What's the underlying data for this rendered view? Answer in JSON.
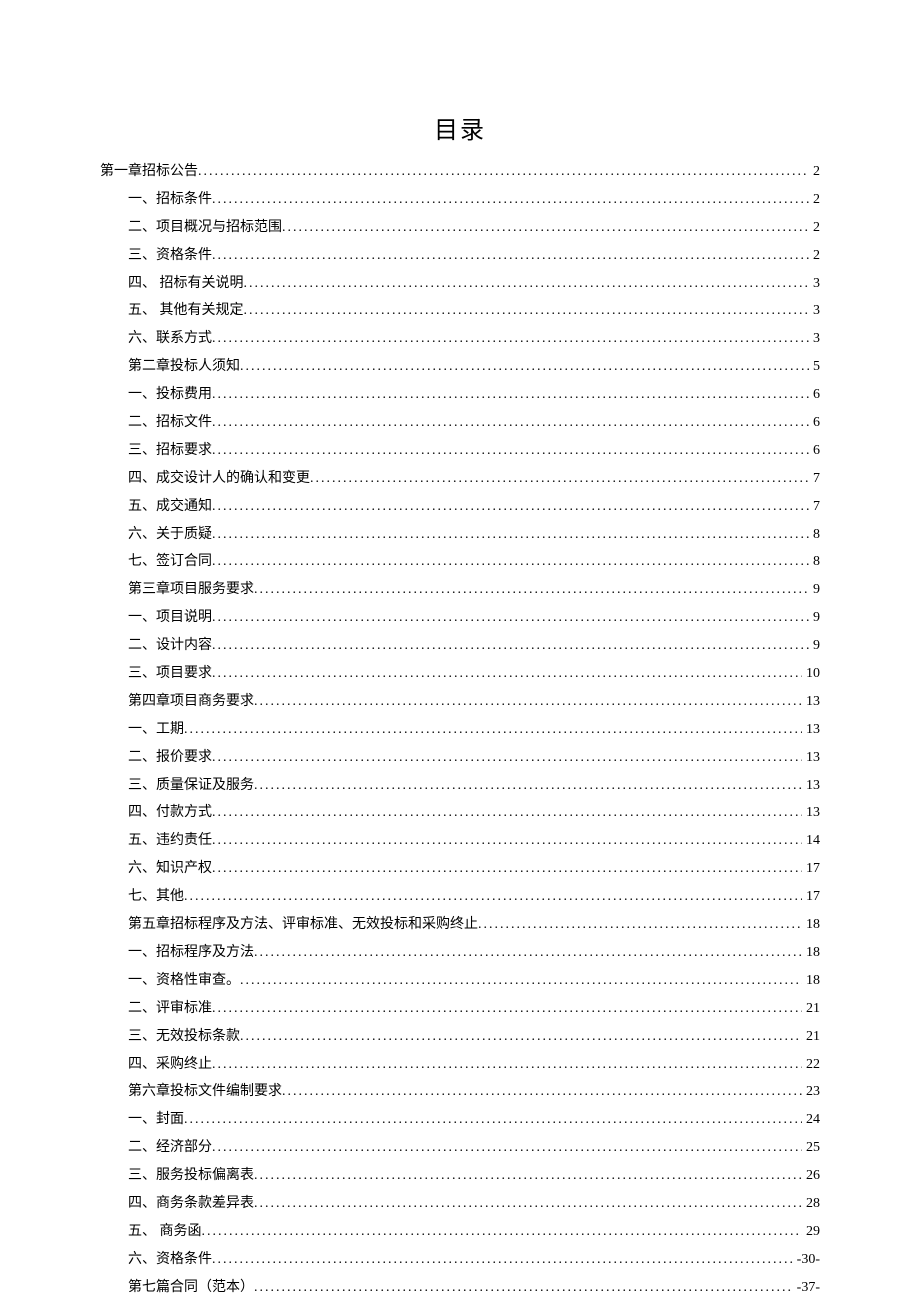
{
  "title": "目录",
  "entries": [
    {
      "level": 1,
      "label": "第一章招标公告",
      "page": "2"
    },
    {
      "level": 2,
      "label": "一、招标条件",
      "page": "2"
    },
    {
      "level": 2,
      "label": "二、项目概况与招标范围",
      "page": "2"
    },
    {
      "level": 2,
      "label": "三、资格条件",
      "page": "2"
    },
    {
      "level": 2,
      "label": "四、 招标有关说明",
      "page": "3"
    },
    {
      "level": 2,
      "label": "五、 其他有关规定",
      "page": "3"
    },
    {
      "level": 2,
      "label": "六、联系方式",
      "page": "3"
    },
    {
      "level": 2,
      "label": "第二章投标人须知",
      "page": "5"
    },
    {
      "level": 2,
      "label": "一、投标费用",
      "page": "6"
    },
    {
      "level": 2,
      "label": "二、招标文件",
      "page": "6"
    },
    {
      "level": 2,
      "label": "三、招标要求",
      "page": "6"
    },
    {
      "level": 2,
      "label": "四、成交设计人的确认和变更",
      "page": "7"
    },
    {
      "level": 2,
      "label": "五、成交通知",
      "page": "7"
    },
    {
      "level": 2,
      "label": "六、关于质疑",
      "page": "8"
    },
    {
      "level": 2,
      "label": "七、签订合同",
      "page": "8"
    },
    {
      "level": 2,
      "label": "第三章项目服务要求",
      "page": "9"
    },
    {
      "level": 2,
      "label": "一、项目说明",
      "page": "9"
    },
    {
      "level": 2,
      "label": "二、设计内容",
      "page": "9"
    },
    {
      "level": 2,
      "label": "三、项目要求 ",
      "page": " 10"
    },
    {
      "level": 2,
      "label": "第四章项目商务要求 ",
      "page": " 13"
    },
    {
      "level": 2,
      "label": "一、工期 ",
      "page": " 13"
    },
    {
      "level": 2,
      "label": "二、报价要求 ",
      "page": " 13"
    },
    {
      "level": 2,
      "label": "三、质量保证及服务 ",
      "page": " 13"
    },
    {
      "level": 2,
      "label": "四、付款方式 ",
      "page": " 13"
    },
    {
      "level": 2,
      "label": "五、违约责任 ",
      "page": " 14"
    },
    {
      "level": 2,
      "label": "六、知识产权 ",
      "page": " 17"
    },
    {
      "level": 2,
      "label": "七、其他 ",
      "page": " 17"
    },
    {
      "level": 2,
      "label": "第五章招标程序及方法、评审标准、无效投标和采购终止 ",
      "page": " 18"
    },
    {
      "level": 2,
      "label": "一、招标程序及方法 ",
      "page": " 18"
    },
    {
      "level": 2,
      "label": "一、资格性审查。 ",
      "page": " 18"
    },
    {
      "level": 2,
      "label": "二、评审标准 ",
      "page": " 21"
    },
    {
      "level": 2,
      "label": "三、无效投标条款 ",
      "page": " 21"
    },
    {
      "level": 2,
      "label": "四、采购终止 ",
      "page": " 22"
    },
    {
      "level": 2,
      "label": "第六章投标文件编制要求 ",
      "page": " 23"
    },
    {
      "level": 2,
      "label": "一、封面 ",
      "page": " 24"
    },
    {
      "level": 2,
      "label": "二、经济部分 ",
      "page": " 25"
    },
    {
      "level": 2,
      "label": "三、服务投标偏离表 ",
      "page": " 26"
    },
    {
      "level": 2,
      "label": "四、商务条款差异表 ",
      "page": " 28"
    },
    {
      "level": 2,
      "label": "五、 商务函 ",
      "page": " 29"
    },
    {
      "level": 2,
      "label": "六、资格条件",
      "page": "-30-"
    },
    {
      "level": 2,
      "label": "第七篇合同（范本）",
      "page": "-37-"
    }
  ]
}
